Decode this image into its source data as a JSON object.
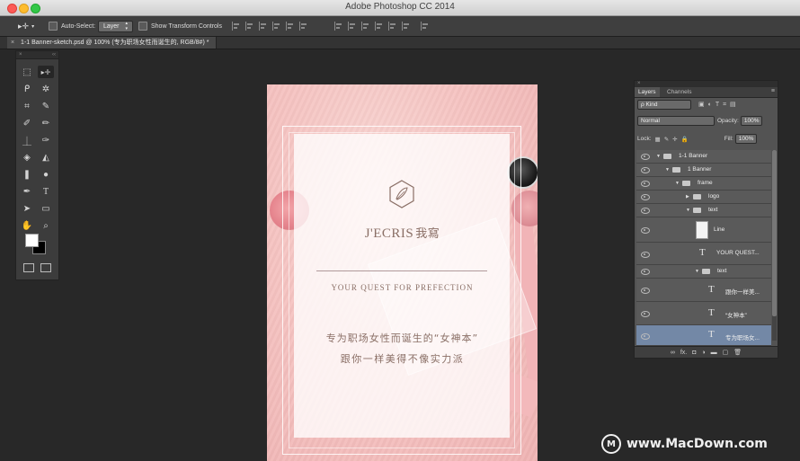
{
  "window": {
    "title": "Adobe Photoshop CC 2014"
  },
  "options_bar": {
    "tool_glyph": "▸✛",
    "auto_select_label": "Auto-Select:",
    "auto_select_value": "Layer",
    "show_transform_label": "Show Transform Controls"
  },
  "document_tab": {
    "close": "×",
    "label": "1-1 Banner-sketch.psd @ 100% (专为职场女性而诞生的, RGB/8#) *"
  },
  "tools": {
    "collapse": "×",
    "expand": "‹‹",
    "items": [
      {
        "glyph": "⬚"
      },
      {
        "glyph": "▸✛"
      },
      {
        "glyph": "ᑭ"
      },
      {
        "glyph": "✲"
      },
      {
        "glyph": "⌗"
      },
      {
        "glyph": "✎"
      },
      {
        "glyph": "✐"
      },
      {
        "glyph": "✏"
      },
      {
        "glyph": "⏊"
      },
      {
        "glyph": "✑"
      },
      {
        "glyph": "◈"
      },
      {
        "glyph": "◭"
      },
      {
        "glyph": "❚"
      },
      {
        "glyph": "●"
      },
      {
        "glyph": "✒"
      },
      {
        "glyph": "T"
      },
      {
        "glyph": "➤"
      },
      {
        "glyph": "▭"
      },
      {
        "glyph": "✋"
      },
      {
        "glyph": "⌕"
      }
    ]
  },
  "artboard": {
    "brand_latin": "J'ECRIS",
    "brand_cn": "我寫",
    "tagline": "YOUR QUEST FOR PREFECTION",
    "line1": "专为职场女性而诞生的“女神本”",
    "line2": "跟你一样美得不像实力派"
  },
  "layers_panel": {
    "collapse": "×",
    "menu": "≡",
    "tabs": [
      "Layers",
      "Channels"
    ],
    "filter_kind": "ρ Kind",
    "blend_mode": "Normal",
    "opacity_label": "Opacity:",
    "opacity_value": "100%",
    "lock_label": "Lock:",
    "fill_label": "Fill:",
    "fill_value": "100%",
    "rows": [
      {
        "name": "1-1 Banner",
        "type": "group"
      },
      {
        "name": "1 Banner",
        "type": "group"
      },
      {
        "name": "frame",
        "type": "group"
      },
      {
        "name": "logo",
        "type": "group"
      },
      {
        "name": "text",
        "type": "group"
      },
      {
        "name": "Line",
        "type": "pixel"
      },
      {
        "name": "YOUR QUEST...",
        "type": "text"
      },
      {
        "name": "text",
        "type": "group"
      },
      {
        "name": "跟你一样美...",
        "type": "text"
      },
      {
        "name": "“女神本”",
        "type": "text"
      },
      {
        "name": "专为职场女...",
        "type": "text"
      }
    ],
    "footer": [
      "∞",
      "fx.",
      "◘",
      "◑",
      "▬",
      "▢",
      "🗑"
    ]
  },
  "watermark": {
    "logo": "M",
    "text": "www.MacDown.com"
  }
}
